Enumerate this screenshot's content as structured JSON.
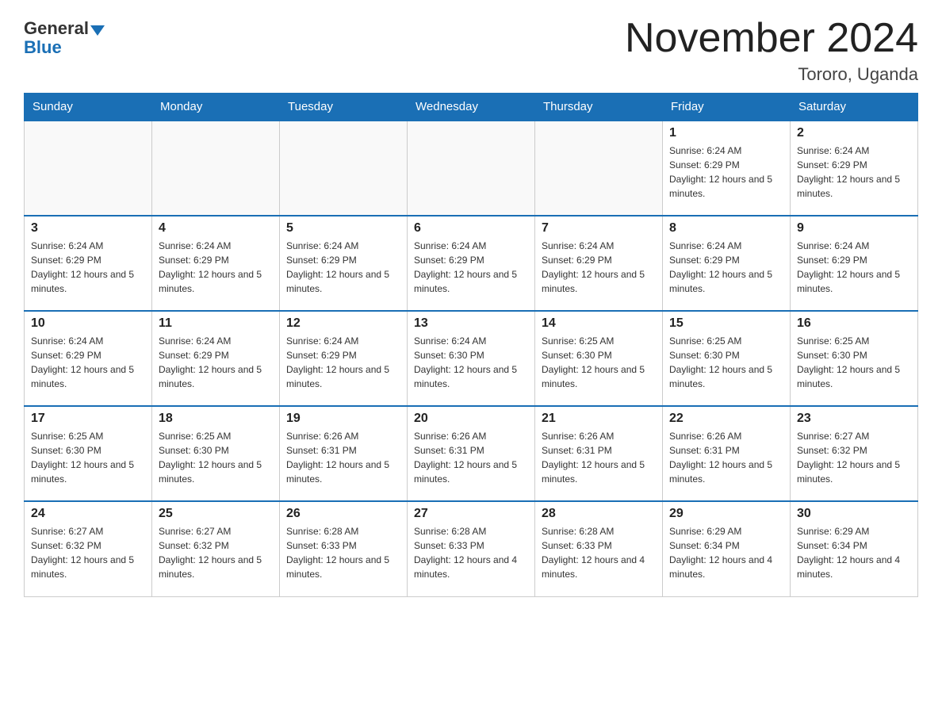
{
  "header": {
    "logo": {
      "general": "General",
      "blue": "Blue"
    },
    "title": "November 2024",
    "location": "Tororo, Uganda"
  },
  "weekdays": [
    "Sunday",
    "Monday",
    "Tuesday",
    "Wednesday",
    "Thursday",
    "Friday",
    "Saturday"
  ],
  "weeks": [
    [
      {
        "day": null,
        "info": null
      },
      {
        "day": null,
        "info": null
      },
      {
        "day": null,
        "info": null
      },
      {
        "day": null,
        "info": null
      },
      {
        "day": null,
        "info": null
      },
      {
        "day": "1",
        "info": "Sunrise: 6:24 AM\nSunset: 6:29 PM\nDaylight: 12 hours and 5 minutes."
      },
      {
        "day": "2",
        "info": "Sunrise: 6:24 AM\nSunset: 6:29 PM\nDaylight: 12 hours and 5 minutes."
      }
    ],
    [
      {
        "day": "3",
        "info": "Sunrise: 6:24 AM\nSunset: 6:29 PM\nDaylight: 12 hours and 5 minutes."
      },
      {
        "day": "4",
        "info": "Sunrise: 6:24 AM\nSunset: 6:29 PM\nDaylight: 12 hours and 5 minutes."
      },
      {
        "day": "5",
        "info": "Sunrise: 6:24 AM\nSunset: 6:29 PM\nDaylight: 12 hours and 5 minutes."
      },
      {
        "day": "6",
        "info": "Sunrise: 6:24 AM\nSunset: 6:29 PM\nDaylight: 12 hours and 5 minutes."
      },
      {
        "day": "7",
        "info": "Sunrise: 6:24 AM\nSunset: 6:29 PM\nDaylight: 12 hours and 5 minutes."
      },
      {
        "day": "8",
        "info": "Sunrise: 6:24 AM\nSunset: 6:29 PM\nDaylight: 12 hours and 5 minutes."
      },
      {
        "day": "9",
        "info": "Sunrise: 6:24 AM\nSunset: 6:29 PM\nDaylight: 12 hours and 5 minutes."
      }
    ],
    [
      {
        "day": "10",
        "info": "Sunrise: 6:24 AM\nSunset: 6:29 PM\nDaylight: 12 hours and 5 minutes."
      },
      {
        "day": "11",
        "info": "Sunrise: 6:24 AM\nSunset: 6:29 PM\nDaylight: 12 hours and 5 minutes."
      },
      {
        "day": "12",
        "info": "Sunrise: 6:24 AM\nSunset: 6:29 PM\nDaylight: 12 hours and 5 minutes."
      },
      {
        "day": "13",
        "info": "Sunrise: 6:24 AM\nSunset: 6:30 PM\nDaylight: 12 hours and 5 minutes."
      },
      {
        "day": "14",
        "info": "Sunrise: 6:25 AM\nSunset: 6:30 PM\nDaylight: 12 hours and 5 minutes."
      },
      {
        "day": "15",
        "info": "Sunrise: 6:25 AM\nSunset: 6:30 PM\nDaylight: 12 hours and 5 minutes."
      },
      {
        "day": "16",
        "info": "Sunrise: 6:25 AM\nSunset: 6:30 PM\nDaylight: 12 hours and 5 minutes."
      }
    ],
    [
      {
        "day": "17",
        "info": "Sunrise: 6:25 AM\nSunset: 6:30 PM\nDaylight: 12 hours and 5 minutes."
      },
      {
        "day": "18",
        "info": "Sunrise: 6:25 AM\nSunset: 6:30 PM\nDaylight: 12 hours and 5 minutes."
      },
      {
        "day": "19",
        "info": "Sunrise: 6:26 AM\nSunset: 6:31 PM\nDaylight: 12 hours and 5 minutes."
      },
      {
        "day": "20",
        "info": "Sunrise: 6:26 AM\nSunset: 6:31 PM\nDaylight: 12 hours and 5 minutes."
      },
      {
        "day": "21",
        "info": "Sunrise: 6:26 AM\nSunset: 6:31 PM\nDaylight: 12 hours and 5 minutes."
      },
      {
        "day": "22",
        "info": "Sunrise: 6:26 AM\nSunset: 6:31 PM\nDaylight: 12 hours and 5 minutes."
      },
      {
        "day": "23",
        "info": "Sunrise: 6:27 AM\nSunset: 6:32 PM\nDaylight: 12 hours and 5 minutes."
      }
    ],
    [
      {
        "day": "24",
        "info": "Sunrise: 6:27 AM\nSunset: 6:32 PM\nDaylight: 12 hours and 5 minutes."
      },
      {
        "day": "25",
        "info": "Sunrise: 6:27 AM\nSunset: 6:32 PM\nDaylight: 12 hours and 5 minutes."
      },
      {
        "day": "26",
        "info": "Sunrise: 6:28 AM\nSunset: 6:33 PM\nDaylight: 12 hours and 5 minutes."
      },
      {
        "day": "27",
        "info": "Sunrise: 6:28 AM\nSunset: 6:33 PM\nDaylight: 12 hours and 4 minutes."
      },
      {
        "day": "28",
        "info": "Sunrise: 6:28 AM\nSunset: 6:33 PM\nDaylight: 12 hours and 4 minutes."
      },
      {
        "day": "29",
        "info": "Sunrise: 6:29 AM\nSunset: 6:34 PM\nDaylight: 12 hours and 4 minutes."
      },
      {
        "day": "30",
        "info": "Sunrise: 6:29 AM\nSunset: 6:34 PM\nDaylight: 12 hours and 4 minutes."
      }
    ]
  ]
}
